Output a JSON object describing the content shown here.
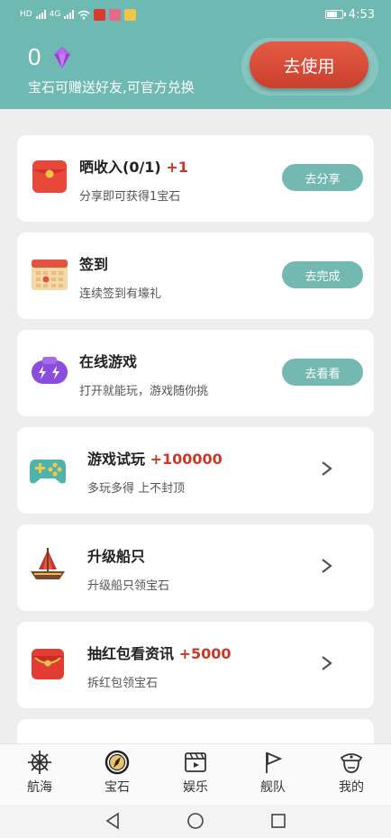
{
  "status_bar": {
    "left_labels": [
      "HD",
      "4G",
      "4G"
    ],
    "time": "4:53"
  },
  "wallet": {
    "gem_count": "0",
    "tip": "宝石可赠送好友,可官方兑换",
    "use_button": "去使用"
  },
  "tasks": [
    {
      "title": "晒收入(0/1)",
      "bonus": "+1",
      "subtitle": "分享即可获得1宝石",
      "action": "去分享",
      "icon": "red-envelope-icon"
    },
    {
      "title": "签到",
      "bonus": "",
      "subtitle": "连续签到有壕礼",
      "action": "去完成",
      "icon": "calendar-icon"
    },
    {
      "title": "在线游戏",
      "bonus": "",
      "subtitle": "打开就能玩，游戏随你挑",
      "action": "去看看",
      "icon": "gamepad-lightning-icon"
    },
    {
      "title": "游戏试玩",
      "bonus": "+100000",
      "subtitle": "多玩多得 上不封顶",
      "action": ">",
      "icon": "green-gamepad-icon"
    },
    {
      "title": "升级船只",
      "bonus": "",
      "subtitle": "升级船只领宝石",
      "action": ">",
      "icon": "ship-icon"
    },
    {
      "title": "抽红包看资讯",
      "bonus": "+5000",
      "subtitle": "拆红包领宝石",
      "action": ">",
      "icon": "red-pouch-icon"
    }
  ],
  "tabs": [
    {
      "label": "航海",
      "icon": "helm-icon",
      "active": false
    },
    {
      "label": "宝石",
      "icon": "compass-icon",
      "active": true
    },
    {
      "label": "娱乐",
      "icon": "clapper-icon",
      "active": false
    },
    {
      "label": "舰队",
      "icon": "flag-icon",
      "active": false
    },
    {
      "label": "我的",
      "icon": "captain-icon",
      "active": false
    }
  ],
  "colors": {
    "header": "#6fb9b3",
    "accent_red": "#c8392b",
    "action_teal": "#74b8b2"
  }
}
